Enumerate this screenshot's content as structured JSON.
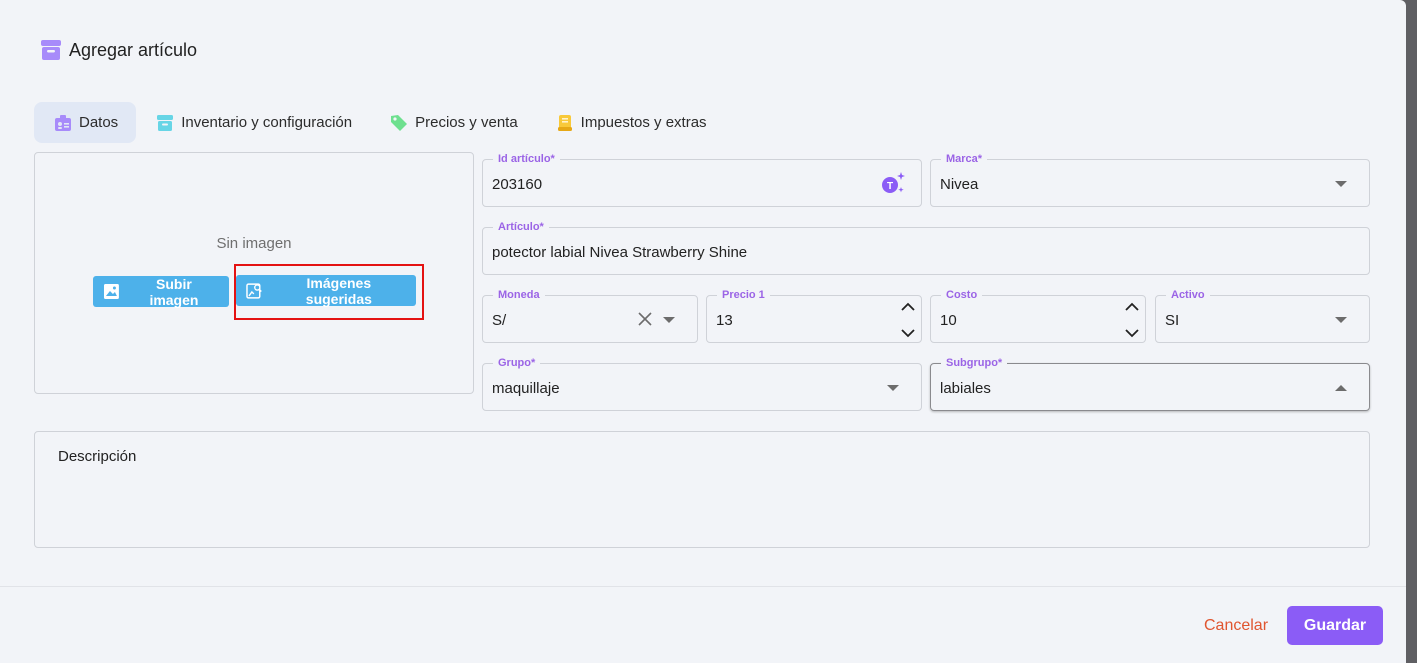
{
  "dialog": {
    "title": "Agregar artículo"
  },
  "tabs": [
    {
      "label": "Datos",
      "icon": "id-badge-icon",
      "active": true
    },
    {
      "label": "Inventario y configuración",
      "icon": "archive-box-icon"
    },
    {
      "label": "Precios y venta",
      "icon": "price-tag-icon"
    },
    {
      "label": "Impuestos y extras",
      "icon": "receipt-icon"
    }
  ],
  "image_panel": {
    "empty_text": "Sin imagen",
    "upload_label": "Subir imagen",
    "suggested_label": "Imágenes sugeridas"
  },
  "fields": {
    "id_articulo": {
      "label": "Id artículo*",
      "value": "203160"
    },
    "marca": {
      "label": "Marca*",
      "value": "Nivea"
    },
    "articulo": {
      "label": "Artículo*",
      "value": "potector labial Nivea Strawberry Shine"
    },
    "moneda": {
      "label": "Moneda",
      "value": "S/"
    },
    "precio1": {
      "label": "Precio 1",
      "value": "13"
    },
    "costo": {
      "label": "Costo",
      "value": "10"
    },
    "activo": {
      "label": "Activo",
      "value": "SI"
    },
    "grupo": {
      "label": "Grupo*",
      "value": "maquillaje"
    },
    "subgrupo": {
      "label": "Subgrupo*",
      "value": "labiales"
    }
  },
  "descripcion": {
    "label": "Descripción"
  },
  "footer": {
    "cancel_label": "Cancelar",
    "save_label": "Guardar"
  },
  "colors": {
    "accent": "#8b5cf6",
    "label": "#9b64e6",
    "blue_button": "#4db1ea",
    "cancel": "#e0552f",
    "highlight": "#e41212"
  }
}
